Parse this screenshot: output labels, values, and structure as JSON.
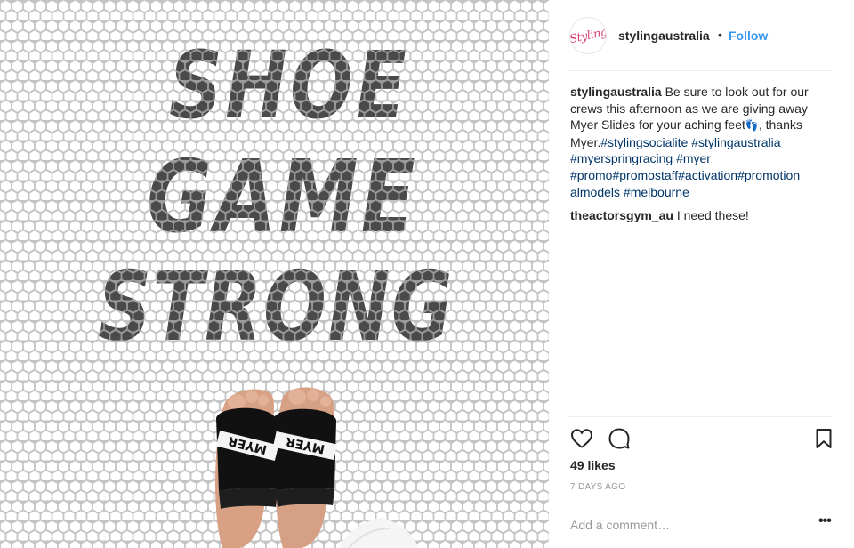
{
  "post": {
    "image_text": "SHOE GAME STRONG",
    "image_text_lines": [
      "SHOE",
      "GAME",
      "STRONG"
    ],
    "slide_brand": "MYER",
    "colors": {
      "tile_dark": "#4a4a4a",
      "tile_light": "#ffffff",
      "grout": "#bdbdbd",
      "link": "#003569",
      "follow": "#3897f0"
    }
  },
  "header": {
    "avatar_text": "Styling",
    "username": "stylingaustralia",
    "dot": "•",
    "follow_label": "Follow"
  },
  "caption": {
    "username": "stylingaustralia",
    "lines": [
      "Be sure to look out for our",
      "crews this afternoon as we are giving away",
      "Myer Slides for your aching feet",
      ", thanks"
    ],
    "feet_emoji": "👣",
    "myer_prefix": "Myer.",
    "hashtags": [
      "#stylingsocialite",
      "#stylingaustralia",
      "#myerspringracing",
      "#myer",
      "#promo#promostaff#activation#promotion",
      "almodels",
      "#melbourne"
    ]
  },
  "comment": {
    "username": "theactorsgym_au",
    "text": "I need these!"
  },
  "actions": {
    "like_icon": "heart-outline-icon",
    "comment_icon": "speech-bubble-icon",
    "save_icon": "bookmark-icon",
    "more_icon": "ellipsis-icon"
  },
  "likes": "49 likes",
  "timestamp": "7 DAYS AGO",
  "add_comment": {
    "placeholder": "Add a comment…",
    "more_label": "•••"
  }
}
